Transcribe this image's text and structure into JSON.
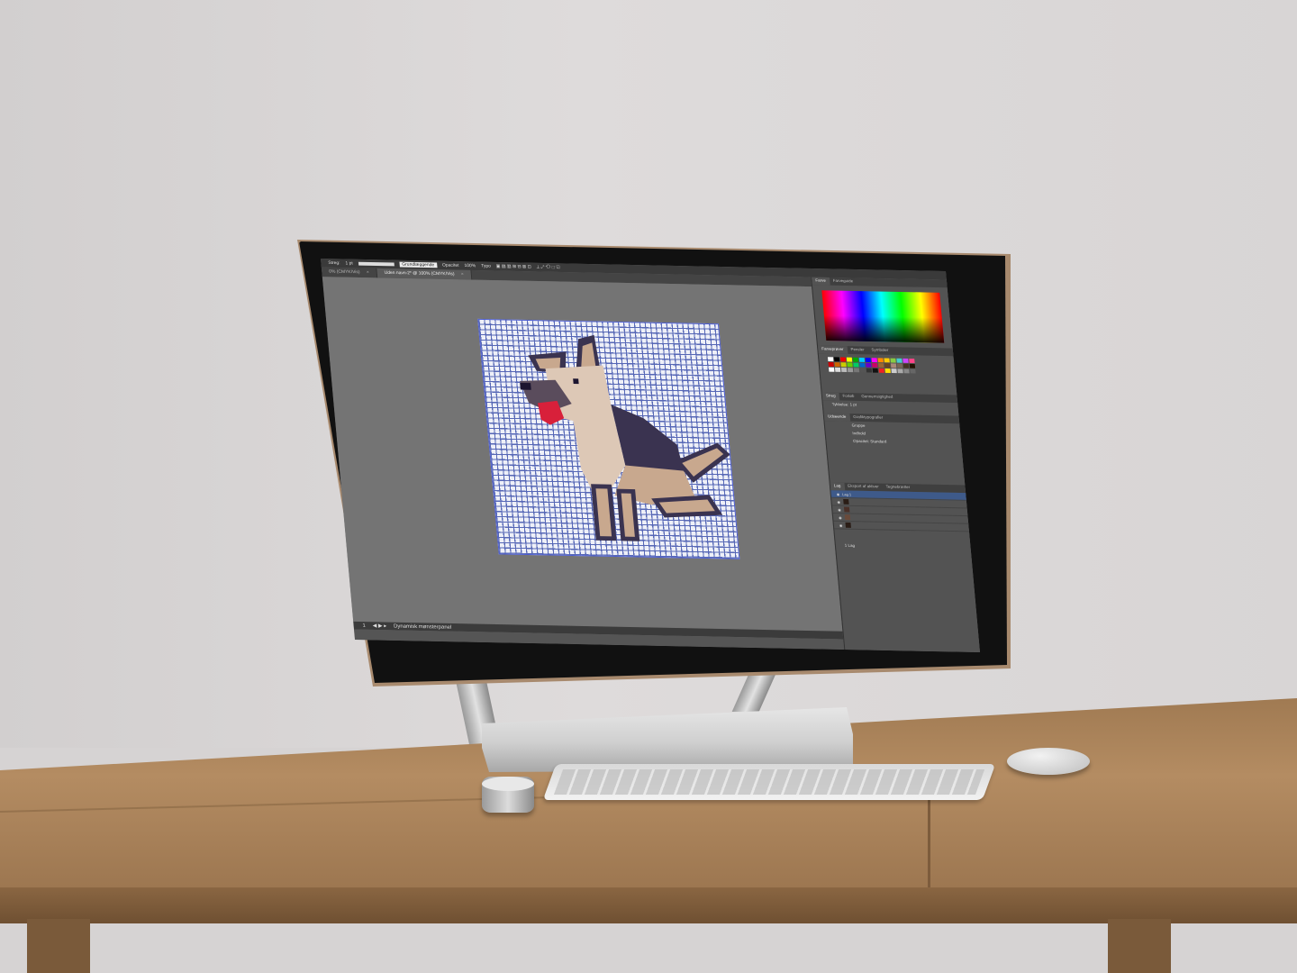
{
  "scene": "desktop-monitor-photo",
  "toolbar": {
    "stroke_label": "Streg:",
    "stroke_value": "1 pt",
    "basic_label": "Grundlæggende",
    "opacity_label": "Opacitet",
    "opacity_value": "100%",
    "style_label": "Typo"
  },
  "tabs": [
    {
      "label": "0% (CMYK/Vis)"
    },
    {
      "label": "Uden navn-2* @ 100% (CMYK/Vis)"
    }
  ],
  "status": {
    "zoom": "1",
    "tool": "Dynamisk mønsterpanel"
  },
  "panel": {
    "color_tabs": [
      "Farve",
      "Farveguide"
    ],
    "swatch_tabs": [
      "Farveprøver",
      "Pensler",
      "Symboler"
    ],
    "stroke_tabs": [
      "Streg",
      "Forløb",
      "Gennemsigtighed"
    ],
    "weight_label": "Tykkelse:",
    "weight_value": "1 pt",
    "appearance_tabs": [
      "Udseende",
      "Grafiktypografier"
    ],
    "appearance_items": [
      "Gruppe",
      "Indhold",
      "Opacitet: Standard"
    ],
    "layer_tabs": [
      "Lag",
      "Eksport af aktiver",
      "Tegnebrætter"
    ],
    "layer_name": "Lag 1",
    "layer_count": "1 Lag"
  },
  "colors": {
    "dog_dark": "#3a3350",
    "dog_tan": "#c8a88e",
    "dog_light": "#ddc8b6",
    "tongue": "#d8203a",
    "grid": "#5667b6"
  }
}
